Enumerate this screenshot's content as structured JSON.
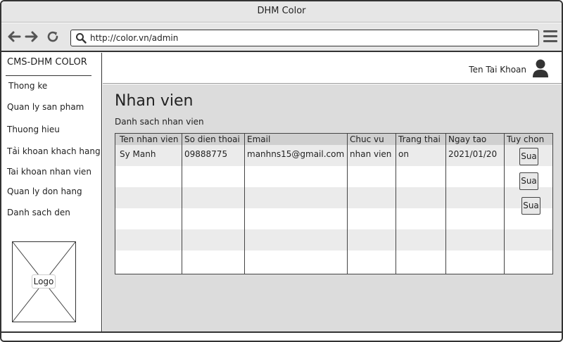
{
  "window": {
    "title": "DHM Color"
  },
  "browser": {
    "url": "http://color.vn/admin",
    "back_icon": "arrow-left-icon",
    "forward_icon": "arrow-right-icon",
    "reload_icon": "reload-icon",
    "menu_icon": "hamburger-menu-icon"
  },
  "sidebar": {
    "brand": "CMS-DHM COLOR",
    "items": [
      {
        "label": "Thong ke"
      },
      {
        "label": "Quan ly san pham"
      },
      {
        "label": "Thuong hieu"
      },
      {
        "label": "Tải khoan khach hang"
      },
      {
        "label": "Tai khoan nhan vien"
      },
      {
        "label": "Quan ly don hang"
      },
      {
        "label": "Danh sach den"
      }
    ],
    "logo_label": "Logo"
  },
  "header": {
    "account_name": "Ten Tai Khoan"
  },
  "main": {
    "title": "Nhan vien",
    "subtitle": "Danh sach nhan vien",
    "table": {
      "columns": [
        "Ten nhan vien",
        "So dien thoai",
        "Email",
        "Chuc vu",
        "Trang thai",
        "Ngay tao",
        "Tuy chon"
      ],
      "rows": [
        [
          "Sy Manh",
          "09888775",
          "manhns15@gmail.com",
          "nhan vien",
          "on",
          "2021/01/20"
        ]
      ],
      "action_label": "Sua",
      "action_buttons": [
        "Sua",
        "Sua",
        "Sua"
      ]
    }
  },
  "colors": {
    "chrome": "#e6e6e6",
    "content_bg": "#dcdcdc",
    "header_row": "#cfcfcf",
    "stripe": "#ebebeb"
  }
}
